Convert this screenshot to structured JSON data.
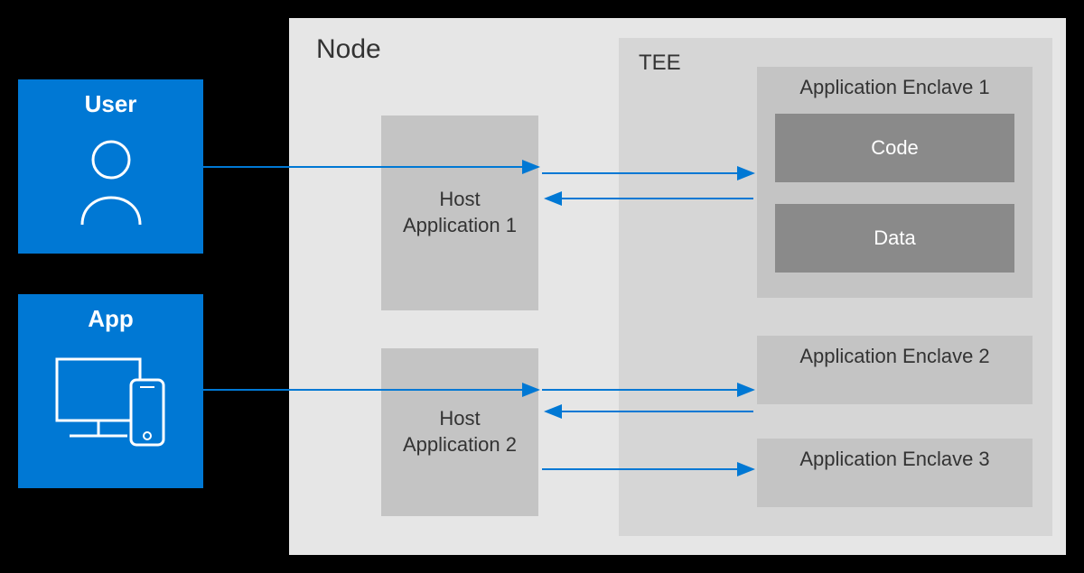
{
  "clients": {
    "user": {
      "title": "User"
    },
    "app": {
      "title": "App"
    }
  },
  "node": {
    "label": "Node",
    "host1": {
      "line1": "Host",
      "line2": "Application 1"
    },
    "host2": {
      "line1": "Host",
      "line2": "Application 2"
    }
  },
  "tee": {
    "label": "TEE",
    "enclave1": {
      "title": "Application Enclave 1",
      "code": "Code",
      "data": "Data"
    },
    "enclave2": {
      "title": "Application Enclave 2"
    },
    "enclave3": {
      "title": "Application Enclave 3"
    }
  },
  "colors": {
    "azure_blue": "#0078d4",
    "arrow_blue": "#0078d4",
    "node_bg": "#e6e6e6",
    "tee_bg": "#d6d6d6",
    "block_bg": "#c4c4c4",
    "inner_bg": "#8a8a8a"
  }
}
